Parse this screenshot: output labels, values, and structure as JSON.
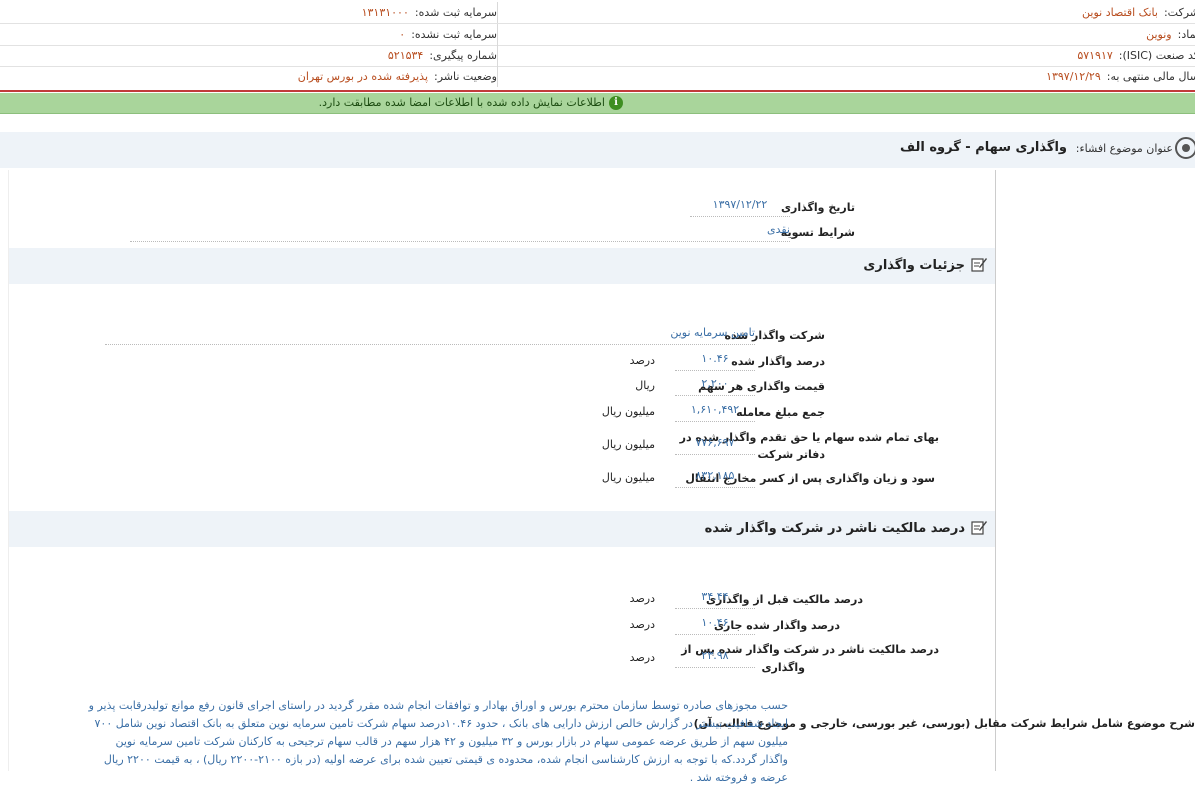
{
  "info": {
    "company_label": "شرکت:",
    "company_value": "بانک اقتصاد نوین",
    "symbol_label": "نماد:",
    "symbol_value": "ونوین",
    "isic_label": "کد صنعت (ISIC):",
    "isic_value": "۵۷۱۹۱۷",
    "fiscal_label": "سال مالی منتهی به:",
    "fiscal_value": "۱۳۹۷/۱۲/۲۹",
    "reg_capital_label": "سرمایه ثبت شده:",
    "reg_capital_value": "۱۳۱۳۱۰۰۰",
    "unreg_capital_label": "سرمایه ثبت نشده:",
    "unreg_capital_value": "۰",
    "tracking_label": "شماره پیگیری:",
    "tracking_value": "۵۲۱۵۳۴",
    "status_label": "وضعیت ناشر:",
    "status_value": "پذیرفته شده در بورس تهران"
  },
  "notice": {
    "text": "اطلاعات نمایش داده شده با اطلاعات امضا شده مطابقت دارد.",
    "icon": "info-icon"
  },
  "subject": {
    "label": "عنوان موضوع افشاء:",
    "title": "واگذاری سهام - گروه الف"
  },
  "general": {
    "date_label": "تاریخ واگذاری",
    "date_value": "۱۳۹۷/۱۲/۲۲",
    "settlement_label": "شرایط تسویه",
    "settlement_value": "نقدی"
  },
  "details": {
    "title": "جزئیات واگذاری",
    "company_label": "شرکت واگذار شده",
    "company_value": "تامین سرمایه نوین",
    "rows": [
      {
        "label": "درصد واگذار شده",
        "value": "۱۰.۴۶",
        "unit": "درصد"
      },
      {
        "label": "قیمت واگذاری هر سهم",
        "value": "۲,۲۰۰",
        "unit": "ریال"
      },
      {
        "label": "جمع مبلغ معامله",
        "value": "۱,۶۱۰,۴۹۲",
        "unit": "میلیون ریال"
      },
      {
        "label": "بهای تمام شده سهام یا حق تقدم واگذار شده در دفاتر شرکت",
        "label_line1": "بهای تمام شده سهام یا حق تقدم واگذار شده در",
        "label_line2": "دفاتر شرکت",
        "value": "۷۷۶,۶۹۷",
        "unit": "میلیون ریال"
      },
      {
        "label": "سود و زیان واگذاری پس از کسر مخارج انتقال",
        "value": "۸۳۲,۱۸۵",
        "unit": "میلیون ریال"
      }
    ]
  },
  "ownership": {
    "title": "درصد مالکیت ناشر در شرکت واگذار شده",
    "rows": [
      {
        "label": "درصد مالکیت قبل از واگذاری",
        "value": "۳۴.۴۴",
        "unit": "درصد"
      },
      {
        "label": "درصد واگذار شده جاری",
        "value": "۱۰.۴۶",
        "unit": "درصد"
      },
      {
        "label_line1": "درصد مالکیت ناشر در شرکت واگذار شده پس از",
        "label_line2": "واگذاری",
        "value": "۲۳.۹۸",
        "unit": "درصد"
      }
    ]
  },
  "description": {
    "label": "شرح موضوع شامل شرایط شرکت مقابل (بورسی، غیر بورسی، خارجی و موضوع فعالیت آن)",
    "text": "حسب مجوزهای صادره توسط سازمان محترم بورس و اوراق بهادار و توافقات انجام شده مقرر گردید در راستای اجرای قانون رفع موانع تولیدرقابت پذیر و ایجاد شفافیت بیشتر در گزارش خالص ارزش دارایی های بانک ، حدود ۱۰.۴۶درصد سهام شرکت تامین سرمایه نوین متعلق به بانک اقتصاد نوین شامل ۷۰۰ میلیون سهم از طریق عرضه عمومی سهام در بازار بورس و ۳۲ میلیون و ۴۲ هزار سهم در قالب سهام ترجیحی به کارکنان شرکت تامین سرمایه نوین واگذار گردد.که با توجه به ارزش کارشناسی انجام شده، محدوده ی قیمتی تعیین شده برای عرضه اولیه (در بازه ۲۱۰۰-۲۲۰۰ ریال) ، به قیمت ۲۲۰۰ ریال عرضه و فروخته شد ."
  }
}
